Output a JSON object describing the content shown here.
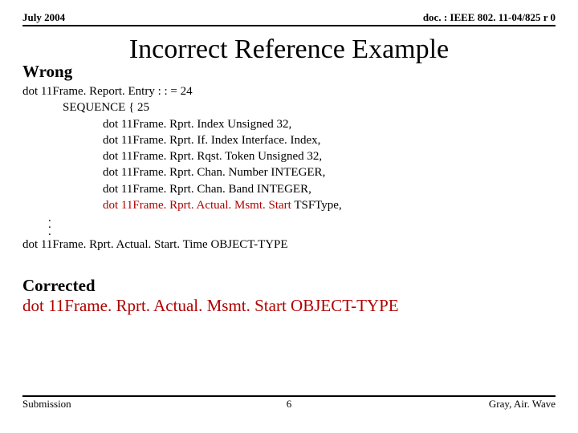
{
  "header": {
    "date": "July 2004",
    "doc": "doc. : IEEE 802. 11-04/825 r 0"
  },
  "title": "Incorrect Reference Example",
  "wrong_label": "Wrong",
  "asn": {
    "line1": "dot 11Frame. Report. Entry : : = 24",
    "line2": "SEQUENCE { 25",
    "line3": "dot 11Frame. Rprt. Index Unsigned 32,",
    "line4": "dot 11Frame. Rprt. If. Index Interface. Index,",
    "line5": "dot 11Frame. Rprt. Rqst. Token Unsigned 32,",
    "line6": "dot 11Frame. Rprt. Chan. Number INTEGER,",
    "line7": "dot 11Frame. Rprt. Chan. Band INTEGER,",
    "line8a": "dot 11Frame. Rprt. Actual. Msmt. Start",
    "line8b": " TSFType,"
  },
  "ellipsis": {
    "d1": ".",
    "d2": ".",
    "d3": "."
  },
  "obj_line": "dot 11Frame. Rprt. Actual. Start. Time  OBJECT-TYPE",
  "corrected_label": "Corrected",
  "corrected_line": "dot 11Frame. Rprt. Actual. Msmt. Start OBJECT-TYPE",
  "footer": {
    "left": "Submission",
    "page": "6",
    "right": "Gray, Air. Wave"
  }
}
